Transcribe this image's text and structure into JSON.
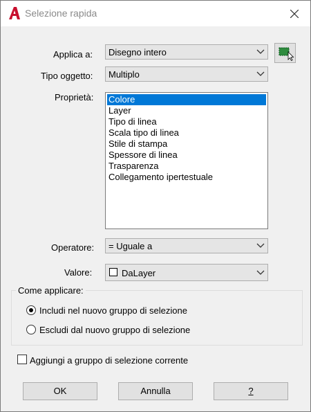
{
  "window": {
    "title": "Selezione rapida"
  },
  "fields": {
    "applica_label": "Applica a:",
    "applica_value": "Disegno intero",
    "tipo_label": "Tipo oggetto:",
    "tipo_value": "Multiplo",
    "proprieta_label": "Proprietà:",
    "operatore_label": "Operatore:",
    "operatore_value": "= Uguale a",
    "valore_label": "Valore:",
    "valore_value": "DaLayer"
  },
  "properties": [
    "Colore",
    "Layer",
    "Tipo di linea",
    "Scala tipo di linea",
    "Stile di stampa",
    "Spessore di linea",
    "Trasparenza",
    "Collegamento ipertestuale"
  ],
  "selected_property": "Colore",
  "apply_group": {
    "title": "Come applicare:",
    "include_label": "Includi nel nuovo gruppo di selezione",
    "exclude_label": "Escludi dal nuovo gruppo di selezione",
    "selected": "include"
  },
  "append_checkbox": {
    "label": "Aggiungi a gruppo di selezione corrente",
    "checked": false
  },
  "buttons": {
    "ok": "OK",
    "cancel": "Annulla",
    "help": "?"
  },
  "colors": {
    "selection": "#0078d7",
    "app_icon": "#c8102e",
    "pick_green": "#2e8b3e"
  }
}
